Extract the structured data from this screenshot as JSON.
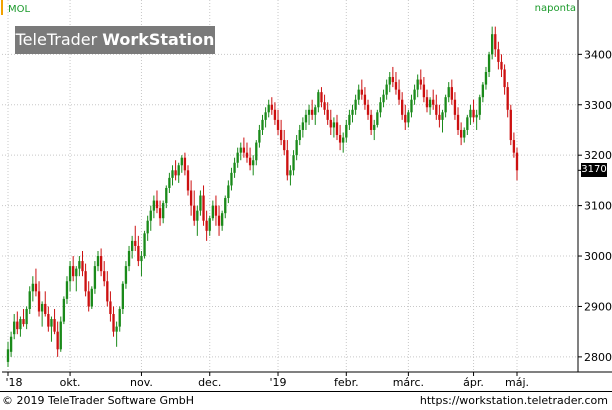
{
  "header": {
    "symbol": "MOL",
    "period": "naponta"
  },
  "logo": {
    "part1": "TeleTrader ",
    "part2": "WorkStation"
  },
  "footer": {
    "copyright": "© 2019 TeleTrader Software GmbH",
    "url": "https://workstation.teletrader.com"
  },
  "colors": {
    "up": "#1a8a1a",
    "down": "#cc1010",
    "grid": "#c8c8c8",
    "label": "#1a9a2a",
    "logo_bg": "#7a7a7a"
  },
  "chart_data": {
    "type": "candlestick",
    "title": "",
    "xlabel": "",
    "ylabel": "",
    "ylim": [
      2770,
      3480
    ],
    "yticks": [
      2800,
      2900,
      3000,
      3100,
      3200,
      3300,
      3400
    ],
    "x_tick_labels": [
      "'18",
      "okt.",
      "nov.",
      "dec.",
      "'19",
      "febr.",
      "márc.",
      "ápr.",
      "máj."
    ],
    "x_tick_dates": [
      "2018-09-03",
      "2018-10-01",
      "2018-11-01",
      "2018-12-03",
      "2019-01-02",
      "2019-02-01",
      "2019-03-01",
      "2019-04-01",
      "2019-05-02"
    ],
    "last_value": "3170",
    "note": "Candle values [open, high, low, close] estimated from the screenshot; one bar per trading day from 2018-09-03 to 2019-05-15.",
    "candles": [
      [
        2790,
        2830,
        2780,
        2815
      ],
      [
        2810,
        2850,
        2800,
        2840
      ],
      [
        2845,
        2885,
        2835,
        2870
      ],
      [
        2870,
        2890,
        2845,
        2855
      ],
      [
        2855,
        2880,
        2840,
        2875
      ],
      [
        2875,
        2895,
        2860,
        2865
      ],
      [
        2865,
        2900,
        2855,
        2895
      ],
      [
        2895,
        2940,
        2885,
        2930
      ],
      [
        2930,
        2960,
        2910,
        2945
      ],
      [
        2945,
        2975,
        2920,
        2930
      ],
      [
        2930,
        2950,
        2880,
        2890
      ],
      [
        2890,
        2910,
        2860,
        2905
      ],
      [
        2905,
        2930,
        2880,
        2885
      ],
      [
        2885,
        2900,
        2850,
        2860
      ],
      [
        2860,
        2880,
        2830,
        2875
      ],
      [
        2875,
        2895,
        2845,
        2850
      ],
      [
        2850,
        2870,
        2800,
        2815
      ],
      [
        2815,
        2880,
        2810,
        2870
      ],
      [
        2870,
        2920,
        2865,
        2915
      ],
      [
        2915,
        2960,
        2905,
        2950
      ],
      [
        2950,
        2990,
        2930,
        2980
      ],
      [
        2980,
        3000,
        2950,
        2960
      ],
      [
        2960,
        2980,
        2930,
        2975
      ],
      [
        2975,
        3000,
        2960,
        2990
      ],
      [
        2990,
        3010,
        2960,
        2970
      ],
      [
        2970,
        2985,
        2920,
        2930
      ],
      [
        2930,
        2950,
        2890,
        2900
      ],
      [
        2900,
        2940,
        2895,
        2935
      ],
      [
        2935,
        2990,
        2925,
        2980
      ],
      [
        2980,
        3010,
        2970,
        3000
      ],
      [
        3000,
        3015,
        2960,
        2970
      ],
      [
        2970,
        2990,
        2940,
        2950
      ],
      [
        2950,
        2970,
        2900,
        2910
      ],
      [
        2910,
        2930,
        2870,
        2885
      ],
      [
        2885,
        2900,
        2840,
        2850
      ],
      [
        2850,
        2870,
        2820,
        2860
      ],
      [
        2860,
        2900,
        2850,
        2895
      ],
      [
        2895,
        2950,
        2885,
        2945
      ],
      [
        2945,
        2990,
        2935,
        2980
      ],
      [
        2980,
        3020,
        2970,
        3010
      ],
      [
        3010,
        3040,
        2995,
        3030
      ],
      [
        3030,
        3060,
        3010,
        3020
      ],
      [
        3020,
        3040,
        2980,
        2990
      ],
      [
        2990,
        3010,
        2960,
        3000
      ],
      [
        3000,
        3050,
        2995,
        3045
      ],
      [
        3045,
        3080,
        3030,
        3070
      ],
      [
        3070,
        3100,
        3050,
        3090
      ],
      [
        3090,
        3120,
        3075,
        3110
      ],
      [
        3110,
        3130,
        3085,
        3095
      ],
      [
        3095,
        3110,
        3060,
        3075
      ],
      [
        3075,
        3110,
        3065,
        3105
      ],
      [
        3105,
        3140,
        3095,
        3135
      ],
      [
        3135,
        3165,
        3125,
        3155
      ],
      [
        3155,
        3180,
        3140,
        3170
      ],
      [
        3170,
        3190,
        3150,
        3160
      ],
      [
        3160,
        3185,
        3145,
        3180
      ],
      [
        3180,
        3200,
        3165,
        3195
      ],
      [
        3195,
        3205,
        3160,
        3170
      ],
      [
        3170,
        3180,
        3120,
        3130
      ],
      [
        3130,
        3150,
        3080,
        3100
      ],
      [
        3100,
        3130,
        3060,
        3070
      ],
      [
        3070,
        3100,
        3040,
        3090
      ],
      [
        3090,
        3130,
        3080,
        3120
      ],
      [
        3120,
        3140,
        3060,
        3070
      ],
      [
        3070,
        3090,
        3030,
        3050
      ],
      [
        3050,
        3080,
        3040,
        3075
      ],
      [
        3075,
        3110,
        3070,
        3100
      ],
      [
        3100,
        3120,
        3060,
        3080
      ],
      [
        3080,
        3100,
        3040,
        3060
      ],
      [
        3060,
        3090,
        3050,
        3085
      ],
      [
        3085,
        3120,
        3075,
        3115
      ],
      [
        3115,
        3150,
        3105,
        3140
      ],
      [
        3140,
        3175,
        3130,
        3165
      ],
      [
        3165,
        3195,
        3155,
        3185
      ],
      [
        3185,
        3215,
        3175,
        3205
      ],
      [
        3205,
        3225,
        3190,
        3215
      ],
      [
        3215,
        3235,
        3195,
        3205
      ],
      [
        3205,
        3225,
        3185,
        3195
      ],
      [
        3195,
        3215,
        3170,
        3180
      ],
      [
        3180,
        3200,
        3160,
        3190
      ],
      [
        3190,
        3230,
        3180,
        3225
      ],
      [
        3225,
        3260,
        3215,
        3250
      ],
      [
        3250,
        3280,
        3240,
        3270
      ],
      [
        3270,
        3295,
        3255,
        3285
      ],
      [
        3285,
        3310,
        3275,
        3300
      ],
      [
        3300,
        3315,
        3280,
        3290
      ],
      [
        3290,
        3305,
        3260,
        3270
      ],
      [
        3270,
        3290,
        3240,
        3250
      ],
      [
        3250,
        3270,
        3220,
        3230
      ],
      [
        3230,
        3250,
        3200,
        3210
      ],
      [
        3210,
        3230,
        3150,
        3160
      ],
      [
        3160,
        3180,
        3140,
        3170
      ],
      [
        3170,
        3210,
        3160,
        3200
      ],
      [
        3200,
        3240,
        3190,
        3230
      ],
      [
        3230,
        3260,
        3220,
        3250
      ],
      [
        3250,
        3275,
        3235,
        3265
      ],
      [
        3265,
        3290,
        3250,
        3280
      ],
      [
        3280,
        3300,
        3260,
        3290
      ],
      [
        3290,
        3310,
        3270,
        3280
      ],
      [
        3280,
        3300,
        3260,
        3295
      ],
      [
        3295,
        3330,
        3285,
        3325
      ],
      [
        3325,
        3335,
        3295,
        3305
      ],
      [
        3305,
        3320,
        3280,
        3290
      ],
      [
        3290,
        3305,
        3260,
        3270
      ],
      [
        3270,
        3290,
        3240,
        3255
      ],
      [
        3255,
        3275,
        3235,
        3265
      ],
      [
        3265,
        3280,
        3230,
        3240
      ],
      [
        3240,
        3260,
        3210,
        3225
      ],
      [
        3225,
        3245,
        3205,
        3235
      ],
      [
        3235,
        3270,
        3225,
        3260
      ],
      [
        3260,
        3290,
        3250,
        3280
      ],
      [
        3280,
        3300,
        3265,
        3290
      ],
      [
        3290,
        3320,
        3280,
        3310
      ],
      [
        3310,
        3340,
        3300,
        3330
      ],
      [
        3330,
        3350,
        3310,
        3320
      ],
      [
        3320,
        3335,
        3290,
        3300
      ],
      [
        3300,
        3310,
        3270,
        3280
      ],
      [
        3280,
        3290,
        3240,
        3250
      ],
      [
        3250,
        3270,
        3230,
        3260
      ],
      [
        3260,
        3290,
        3255,
        3285
      ],
      [
        3285,
        3315,
        3275,
        3305
      ],
      [
        3305,
        3330,
        3295,
        3320
      ],
      [
        3320,
        3350,
        3310,
        3340
      ],
      [
        3340,
        3365,
        3325,
        3355
      ],
      [
        3355,
        3375,
        3335,
        3345
      ],
      [
        3345,
        3365,
        3320,
        3330
      ],
      [
        3330,
        3350,
        3300,
        3310
      ],
      [
        3310,
        3325,
        3270,
        3280
      ],
      [
        3280,
        3300,
        3250,
        3265
      ],
      [
        3265,
        3290,
        3255,
        3285
      ],
      [
        3285,
        3320,
        3275,
        3310
      ],
      [
        3310,
        3340,
        3300,
        3330
      ],
      [
        3330,
        3360,
        3315,
        3350
      ],
      [
        3350,
        3370,
        3330,
        3340
      ],
      [
        3340,
        3355,
        3305,
        3315
      ],
      [
        3315,
        3330,
        3285,
        3295
      ],
      [
        3295,
        3315,
        3280,
        3310
      ],
      [
        3310,
        3330,
        3290,
        3300
      ],
      [
        3300,
        3320,
        3270,
        3280
      ],
      [
        3280,
        3300,
        3255,
        3270
      ],
      [
        3270,
        3290,
        3245,
        3285
      ],
      [
        3285,
        3320,
        3275,
        3315
      ],
      [
        3315,
        3345,
        3305,
        3335
      ],
      [
        3335,
        3350,
        3300,
        3310
      ],
      [
        3310,
        3325,
        3270,
        3280
      ],
      [
        3280,
        3295,
        3240,
        3250
      ],
      [
        3250,
        3265,
        3220,
        3235
      ],
      [
        3235,
        3255,
        3225,
        3250
      ],
      [
        3250,
        3280,
        3240,
        3275
      ],
      [
        3275,
        3300,
        3260,
        3290
      ],
      [
        3290,
        3310,
        3265,
        3275
      ],
      [
        3275,
        3290,
        3250,
        3280
      ],
      [
        3280,
        3320,
        3270,
        3315
      ],
      [
        3315,
        3345,
        3305,
        3340
      ],
      [
        3340,
        3375,
        3330,
        3365
      ],
      [
        3365,
        3405,
        3355,
        3400
      ],
      [
        3400,
        3455,
        3390,
        3440
      ],
      [
        3440,
        3455,
        3395,
        3410
      ],
      [
        3410,
        3425,
        3370,
        3385
      ],
      [
        3385,
        3400,
        3355,
        3370
      ],
      [
        3370,
        3380,
        3320,
        3335
      ],
      [
        3335,
        3345,
        3275,
        3290
      ],
      [
        3290,
        3300,
        3220,
        3230
      ],
      [
        3230,
        3245,
        3195,
        3205
      ],
      [
        3205,
        3215,
        3150,
        3170
      ]
    ]
  }
}
